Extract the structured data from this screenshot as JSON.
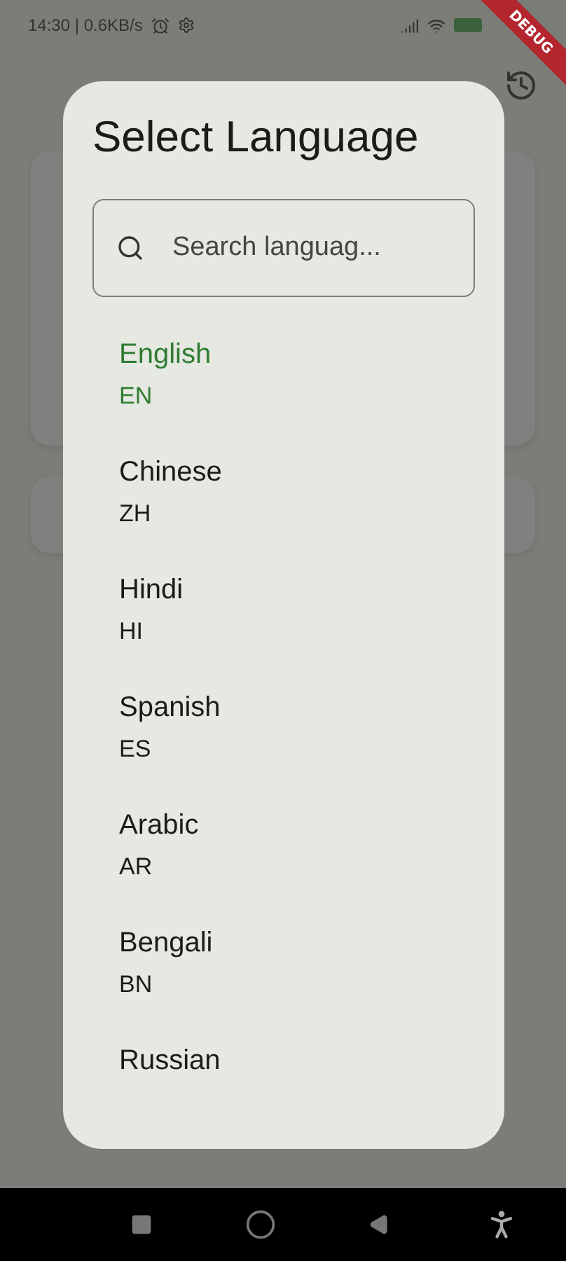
{
  "status_bar": {
    "time": "14:30 | 0.6KB/s"
  },
  "debug_banner": "DEBUG",
  "dialog": {
    "title": "Select Language",
    "search": {
      "placeholder": "Search languag..."
    },
    "languages": [
      {
        "name": "English",
        "code": "EN",
        "selected": true
      },
      {
        "name": "Chinese",
        "code": "ZH",
        "selected": false
      },
      {
        "name": "Hindi",
        "code": "HI",
        "selected": false
      },
      {
        "name": "Spanish",
        "code": "ES",
        "selected": false
      },
      {
        "name": "Arabic",
        "code": "AR",
        "selected": false
      },
      {
        "name": "Bengali",
        "code": "BN",
        "selected": false
      },
      {
        "name": "Russian",
        "selected": false
      }
    ]
  }
}
